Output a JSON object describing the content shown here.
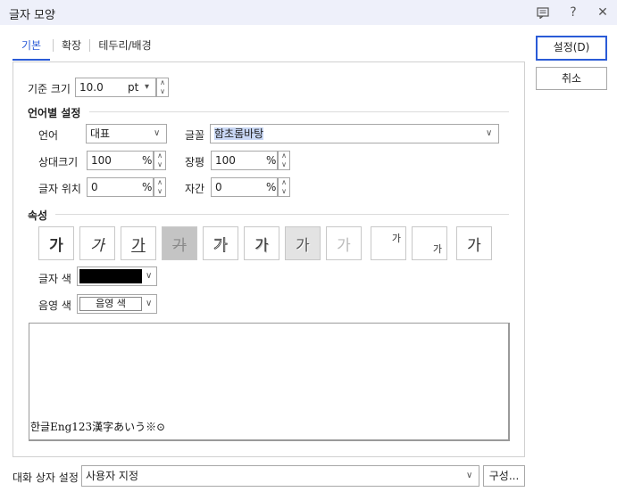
{
  "window": {
    "title": "글자 모양"
  },
  "titlebar": {
    "icons": [
      "comment-icon",
      "help-icon",
      "close-icon"
    ],
    "help_glyph": "?",
    "close_glyph": "✕"
  },
  "tabs": [
    {
      "label": "기본",
      "active": true
    },
    {
      "label": "확장",
      "active": false
    },
    {
      "label": "테두리/배경",
      "active": false
    }
  ],
  "base_size": {
    "label": "기준 크기",
    "value": "10.0",
    "unit": "pt"
  },
  "lang_settings": {
    "header": "언어별 설정",
    "language": {
      "label": "언어",
      "value": "대표"
    },
    "font": {
      "label": "글꼴",
      "value": "함초롬바탕"
    },
    "relative_size": {
      "label": "상대크기",
      "value": "100",
      "unit": "%"
    },
    "width_ratio": {
      "label": "장평",
      "value": "100",
      "unit": "%"
    },
    "char_position": {
      "label": "글자 위치",
      "value": "0",
      "unit": "%"
    },
    "spacing": {
      "label": "자간",
      "value": "0",
      "unit": "%"
    }
  },
  "attributes": {
    "header": "속성",
    "buttons": [
      {
        "name": "bold",
        "glyph": "가",
        "state": "normal"
      },
      {
        "name": "italic",
        "glyph": "가",
        "state": "normal"
      },
      {
        "name": "underline",
        "glyph": "가",
        "state": "normal"
      },
      {
        "name": "strikethrough",
        "glyph": "가",
        "state": "dark"
      },
      {
        "name": "outline",
        "glyph": "가",
        "state": "normal"
      },
      {
        "name": "shadow",
        "glyph": "가",
        "state": "normal"
      },
      {
        "name": "emboss",
        "glyph": "가",
        "state": "pressed"
      },
      {
        "name": "engrave",
        "glyph": "가",
        "state": "normal"
      },
      {
        "name": "superscript",
        "glyph": "가",
        "state": "normal"
      },
      {
        "name": "subscript",
        "glyph": "가",
        "state": "normal"
      },
      {
        "name": "normal",
        "glyph": "가",
        "state": "normal"
      }
    ],
    "text_color": {
      "label": "글자 색",
      "value": "#000000"
    },
    "shade_color": {
      "label": "음영 색",
      "value": "음영 색"
    }
  },
  "preview": {
    "text": "한글Eng123漢字あいう※⊙"
  },
  "footer": {
    "dialog_setting_label": "대화 상자 설정",
    "dialog_setting_value": "사용자 지정",
    "config_button": "구성..."
  },
  "buttons": {
    "ok": "설정(D)",
    "cancel": "취소"
  },
  "colors": {
    "accent": "#2a5bd7",
    "titlebar_bg": "#eef0fa",
    "font_highlight": "#c8d7f5"
  }
}
